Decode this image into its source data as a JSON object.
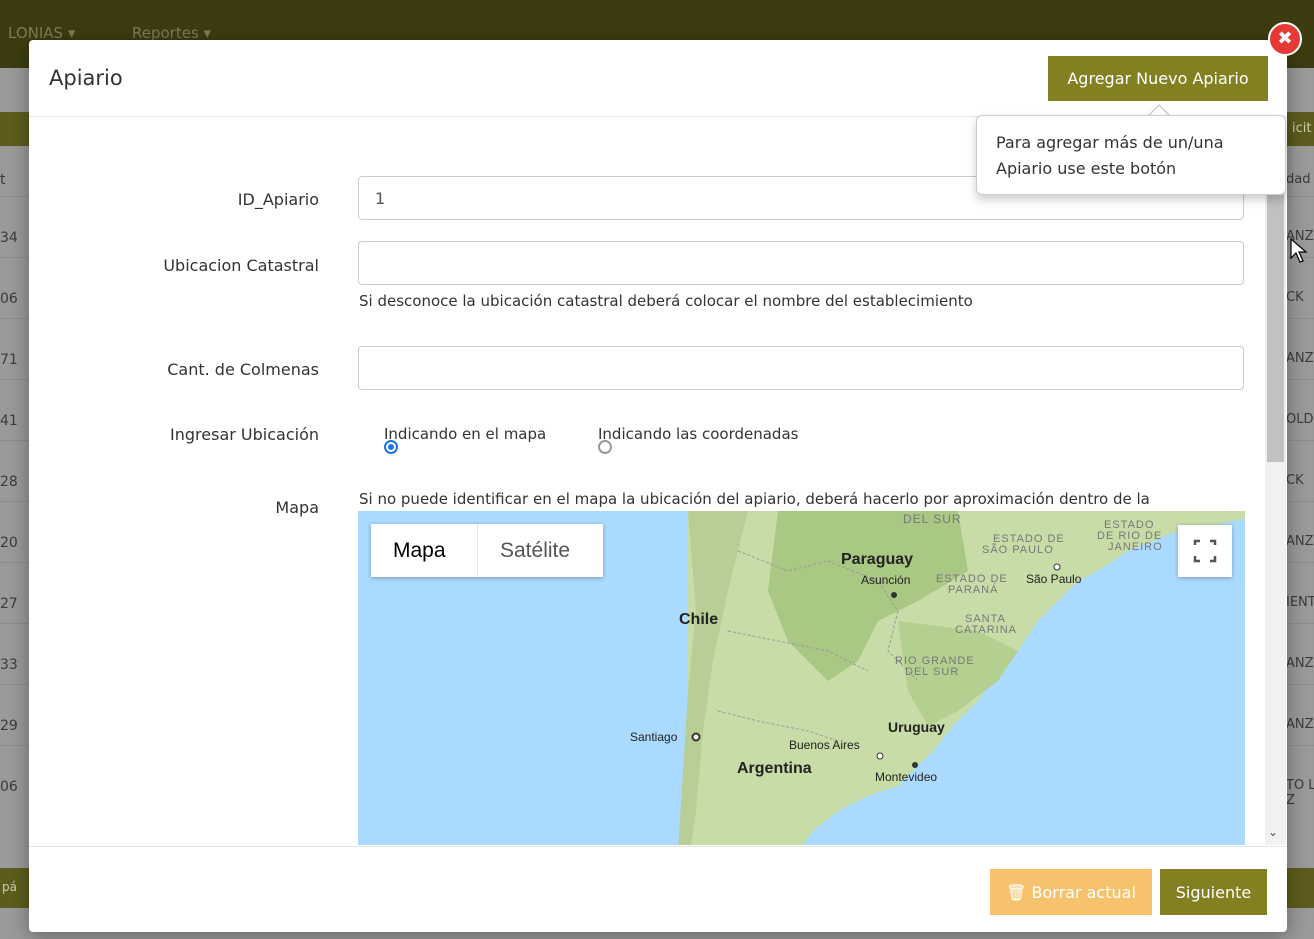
{
  "nav": {
    "items": [
      "LONIAS ▾",
      "Reportes ▾"
    ]
  },
  "background_table": {
    "header_right": "icit",
    "right_top": "dad",
    "left_values": [
      "t",
      "34",
      "06",
      "71",
      "41",
      "28",
      "20",
      "27",
      "33",
      "29",
      "06",
      "pá"
    ],
    "right_values": [
      "ANZ",
      "CK",
      "ANZ",
      "OLD",
      "CK",
      "ANZ",
      "IENT",
      "ANZ",
      "ANZ",
      "TO L\nZ"
    ]
  },
  "modal": {
    "title": "Apiario",
    "add_button": "Agregar Nuevo Apiario",
    "tooltip": "Para agregar más de un/una Apiario use este botón",
    "fields": {
      "id_label": "ID_Apiario",
      "id_value": "1",
      "ubicacion_label": "Ubicacion Catastral",
      "ubicacion_value": "",
      "ubicacion_help": "Si desconoce la ubicación catastral deberá colocar el nombre del establecimiento",
      "colmenas_label": "Cant. de Colmenas",
      "colmenas_value": "",
      "ingresar_label": "Ingresar Ubicación",
      "radio_map": "Indicando en el mapa",
      "radio_coords": "Indicando las coordenadas",
      "mapa_label": "Mapa",
      "mapa_help": "Si no puede identificar en el mapa la ubicación del apiario, deberá hacerlo por aproximación dentro de la localidad o paraje donde estén ubicados."
    },
    "map": {
      "type_map": "Mapa",
      "type_satellite": "Satélite",
      "labels": {
        "del_sur_top": "DEL SUR",
        "estado_sp_1": "ESTADO DE",
        "estado_sp_2": "SÃO PAULO",
        "estado_rj_1": "ESTADO",
        "estado_rj_2": "DE RIO DE",
        "estado_rj_3": "JANEIRO",
        "paraguay": "Paraguay",
        "asuncion": "Asunción",
        "estado_pr_1": "ESTADO DE",
        "estado_pr_2": "PARANÁ",
        "sao_paulo": "São Paulo",
        "chile": "Chile",
        "santa_1": "SANTA",
        "santa_2": "CATARINA",
        "rio_1": "RIO GRANDE",
        "rio_2": "DEL SUR",
        "uruguay": "Uruguay",
        "santiago": "Santiago",
        "buenos_aires": "Buenos Aires",
        "argentina": "Argentina",
        "montevideo": "Montevideo"
      }
    },
    "delete_button": "Borrar actual",
    "next_button": "Siguiente"
  },
  "colors": {
    "olive": "#828020",
    "danger": "#e53935",
    "warning": "#f7c26e",
    "radio": "#1a73e8"
  }
}
